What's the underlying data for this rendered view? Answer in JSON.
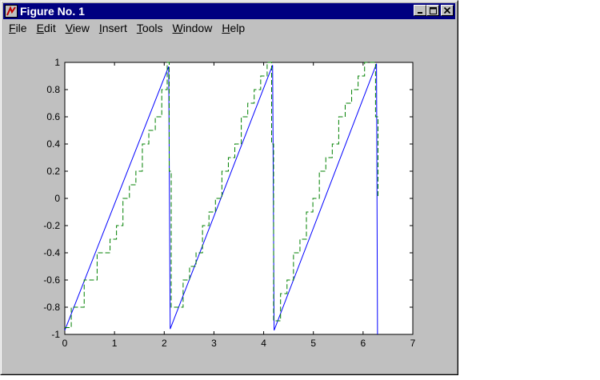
{
  "window": {
    "title": "Figure No. 1",
    "menu": [
      {
        "label_first": "F",
        "label_rest": "ile"
      },
      {
        "label_first": "E",
        "label_rest": "dit"
      },
      {
        "label_first": "V",
        "label_rest": "iew"
      },
      {
        "label_first": "I",
        "label_rest": "nsert"
      },
      {
        "label_first": "T",
        "label_rest": "ools"
      },
      {
        "label_first": "W",
        "label_rest": "indow"
      },
      {
        "label_first": "H",
        "label_rest": "elp"
      }
    ],
    "colors": {
      "titlebar": "#000080",
      "window_bg": "#c0c0c0",
      "plot_bg": "#ffffff",
      "series_solid": "#0000ff",
      "series_dashed": "#008000"
    },
    "icons": [
      "matlab-figure-icon",
      "minimize-icon",
      "maximize-icon",
      "close-icon"
    ]
  },
  "chart_data": {
    "type": "line",
    "title": "",
    "xlabel": "",
    "ylabel": "",
    "xlim": [
      0,
      7
    ],
    "ylim": [
      -1,
      1
    ],
    "xticks": [
      0,
      1,
      2,
      3,
      4,
      5,
      6,
      7
    ],
    "yticks": [
      -1,
      -0.8,
      -0.6,
      -0.4,
      -0.2,
      0,
      0.2,
      0.4,
      0.6,
      0.8,
      1
    ],
    "grid": false,
    "legend": "none",
    "series": [
      {
        "style": "solid",
        "color": "#0000ff",
        "x": [
          0,
          2.09,
          2.12,
          4.18,
          4.21,
          6.27,
          6.29
        ],
        "y": [
          -0.97,
          0.97,
          -0.96,
          0.98,
          -0.97,
          0.99,
          -1.0
        ]
      },
      {
        "style": "dashed-staircase",
        "color": "#008000",
        "x": [
          0,
          0.13,
          0.26,
          0.39,
          0.52,
          0.65,
          0.78,
          0.91,
          1.04,
          1.17,
          1.3,
          1.43,
          1.56,
          1.69,
          1.82,
          1.95,
          2.06,
          2.1,
          2.14,
          2.25,
          2.38,
          2.51,
          2.64,
          2.77,
          2.9,
          3.03,
          3.16,
          3.29,
          3.42,
          3.55,
          3.68,
          3.81,
          3.94,
          4.07,
          4.16,
          4.2,
          4.24,
          4.34,
          4.47,
          4.6,
          4.73,
          4.86,
          4.99,
          5.12,
          5.25,
          5.38,
          5.51,
          5.64,
          5.77,
          5.9,
          6.03,
          6.16,
          6.25,
          6.3
        ],
        "y": [
          -0.95,
          -0.8,
          -0.8,
          -0.6,
          -0.6,
          -0.4,
          -0.4,
          -0.3,
          -0.2,
          0.0,
          0.1,
          0.2,
          0.4,
          0.5,
          0.6,
          0.8,
          1.0,
          0.2,
          -0.8,
          -0.8,
          -0.6,
          -0.5,
          -0.4,
          -0.2,
          -0.1,
          0.0,
          0.2,
          0.3,
          0.4,
          0.6,
          0.7,
          0.8,
          0.9,
          1.0,
          0.4,
          -0.9,
          -0.9,
          -0.7,
          -0.6,
          -0.4,
          -0.3,
          -0.1,
          0.0,
          0.2,
          0.3,
          0.4,
          0.6,
          0.7,
          0.8,
          0.9,
          1.0,
          1.0,
          0.6,
          0.0
        ]
      }
    ]
  }
}
